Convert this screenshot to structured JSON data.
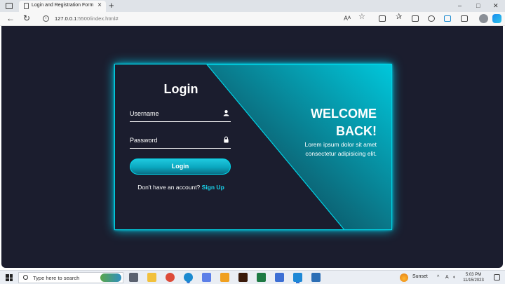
{
  "browser": {
    "tab_title": "Login and Registration Form",
    "tab_close": "×",
    "new_tab": "+",
    "url_host": "127.0.0.1",
    "url_rest": ":5500/index.html#",
    "window_controls": {
      "minimize": "–",
      "maximize": "□",
      "close": "✕"
    },
    "nav": {
      "back": "←",
      "reload": "↻"
    },
    "toolbar": {
      "read_aloud": "Aᴬ",
      "favorite": "☆",
      "favorites": "✰",
      "more": "···"
    }
  },
  "login": {
    "title": "Login",
    "username_label": "Username",
    "password_label": "Password",
    "button_label": "Login",
    "signup_prompt": "Don't have an account?",
    "signup_link": "Sign Up"
  },
  "welcome": {
    "line1": "WELCOME",
    "line2": "BACK!",
    "text": "Lorem ipsum dolor sit amet consectetur adipisicing elit."
  },
  "taskbar": {
    "search_placeholder": "Type here to search",
    "weather": "Sunset",
    "time": "5:03 PM",
    "date": "11/15/2023",
    "tray": {
      "chevron": "^",
      "ime": "A"
    },
    "apps": [
      {
        "name": "task-view",
        "color": "#5b6270"
      },
      {
        "name": "file-explorer",
        "color": "#f2c13c"
      },
      {
        "name": "chrome",
        "color": "#dd4b39"
      },
      {
        "name": "edge",
        "color": "#1b8ad0"
      },
      {
        "name": "store",
        "color": "#5c7fe8"
      },
      {
        "name": "office",
        "color": "#f0a020"
      },
      {
        "name": "illustrator",
        "color": "#3a1a0a"
      },
      {
        "name": "excel",
        "color": "#1e7a44"
      },
      {
        "name": "notepad",
        "color": "#3d6fd4"
      },
      {
        "name": "vscode",
        "color": "#1e88d6"
      },
      {
        "name": "other-app",
        "color": "#2d6fb5"
      }
    ]
  },
  "colors": {
    "accent": "#00d2e4",
    "page_background": "#1b1d2e",
    "panel_dark": "#0b6f80"
  }
}
